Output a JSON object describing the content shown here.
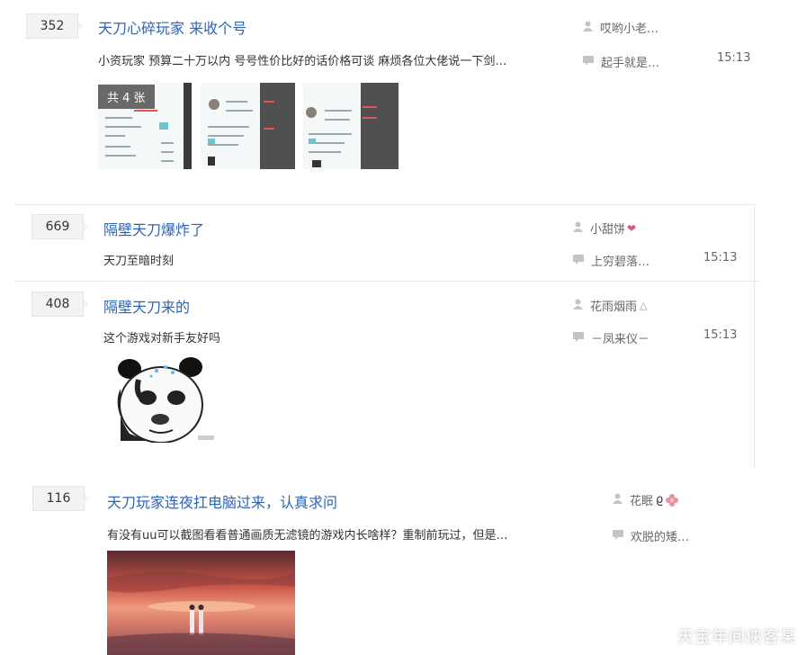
{
  "posts": [
    {
      "replies": "352",
      "title": "天刀心碎玩家 来收个号",
      "abstract": "小资玩家 预算二十万以内 号号性价比好的话价格可谈 麻烦各位大佬说一下剑…",
      "author": "哎哟小老…",
      "last_reply": "起手就是…",
      "time": "15:13",
      "image_count": "共 4 张"
    },
    {
      "replies": "669",
      "title": "隔壁天刀爆炸了",
      "abstract": "天刀至暗时刻",
      "author": "小甜饼",
      "last_reply": "上穷碧落…",
      "time": "15:13"
    },
    {
      "replies": "408",
      "title": "隔壁天刀来的",
      "abstract": "这个游戏对新手友好吗",
      "author": "花雨烟雨",
      "last_reply": "－凤来仪－",
      "time": "15:13"
    },
    {
      "replies": "116",
      "title": "天刀玩家连夜扛电脑过来，认真求问",
      "abstract": "有没有uu可以截图看看普通画质无滤镜的游戏内长啥样？重制前玩过，但是…",
      "author": "花眠",
      "last_reply": "欢脱的矮…"
    }
  ],
  "icons": {
    "author": "user-icon",
    "reply": "comment-icon"
  },
  "colors": {
    "title": "#2d64b3",
    "badge_bg": "#505050"
  },
  "watermark": "天宝年间侠客某"
}
